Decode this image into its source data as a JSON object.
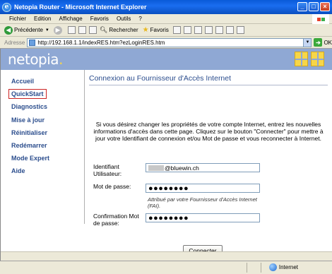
{
  "window": {
    "title": "Netopia Router - Microsoft Internet Explorer",
    "icon": "ie-icon",
    "buttons": [
      "_",
      "□",
      "×"
    ]
  },
  "menubar": {
    "items": [
      "Fichier",
      "Edition",
      "Affichage",
      "Favoris",
      "Outils",
      "?"
    ]
  },
  "toolbar": {
    "back_label": "Précédente",
    "search_label": "Rechercher",
    "favorites_label": "Favoris"
  },
  "addressbar": {
    "label": "Adresse",
    "url": "http://192.168.1.1/indexRES.htm?ezLoginRES.htm",
    "go_label": "OK"
  },
  "header": {
    "logo": "netopia",
    "logo_dot": "."
  },
  "sidebar": {
    "items": [
      {
        "label": "Accueil"
      },
      {
        "label": "QuickStart",
        "active": true
      },
      {
        "label": "Diagnostics"
      },
      {
        "label": "Mise à jour"
      },
      {
        "label": "Réinitialiser"
      },
      {
        "label": "Redémarrer"
      },
      {
        "label": "Mode Expert"
      },
      {
        "label": "Aide"
      }
    ]
  },
  "content": {
    "title": "Connexion au Fournisseur d'Accès Internet",
    "intro": "Si vous désirez changer les propriétés de votre compte Internet, entrez les nouvelles informations d'accès dans cette page. Cliquez sur le bouton \"Connecter\" pour mettre à jour votre Identifiant de connexion et/ou Mot de passe et vous reconnecter à Internet.",
    "username_label": "Identifiant Utilisateur:",
    "username_value": "@bluewin.ch",
    "password_label": "Mot de passe:",
    "password_value": "●●●●●●●●",
    "note": "Attribué par votre Fournisseur d'Accès Internet (FAI).",
    "confirm_label": "Confirmation Mot de passe:",
    "confirm_value": "●●●●●●●●",
    "connect_button": "Connecter"
  },
  "statusbar": {
    "zone": "Internet"
  }
}
